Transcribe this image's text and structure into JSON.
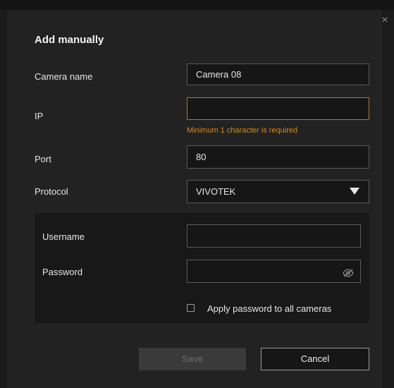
{
  "background_strip": {
    "ghost_text_1": "",
    "ghost_text_2": ""
  },
  "dialog": {
    "title": "Add manually",
    "close_glyph": "×",
    "camera_name": {
      "label": "Camera name",
      "value": "Camera 08"
    },
    "ip": {
      "label": "IP",
      "value": "",
      "error": "Minimum 1 character is required"
    },
    "port": {
      "label": "Port",
      "value": "80"
    },
    "protocol": {
      "label": "Protocol",
      "selected": "VIVOTEK"
    },
    "username": {
      "label": "Username",
      "value": ""
    },
    "password": {
      "label": "Password",
      "value": ""
    },
    "apply_all": {
      "label": "Apply password to all cameras",
      "checked": false
    },
    "buttons": {
      "save": "Save",
      "cancel": "Cancel"
    }
  },
  "colors": {
    "dialog_bg": "#222222",
    "field_bg": "#161616",
    "field_border": "#5a5a5a",
    "error": "#d48a22",
    "disabled_button": "#3a3a3a"
  },
  "icons": {
    "close": "close-icon",
    "dropdown": "caret-down-icon",
    "password_visibility": "eye-slash-icon"
  }
}
